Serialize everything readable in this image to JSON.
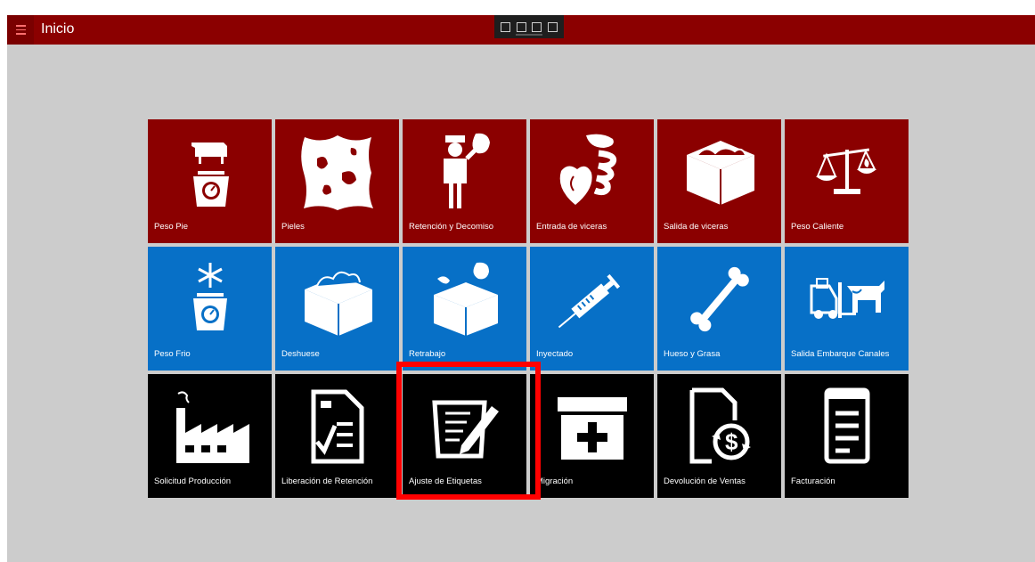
{
  "window": {
    "title": "Inicio"
  },
  "colors": {
    "titlebar": "#8b0000",
    "tile_red": "#8b0000",
    "tile_blue": "#0770c7",
    "tile_black": "#000000",
    "highlight": "#ff0000"
  },
  "debug_toolbar": {
    "icons": [
      "select-element-icon",
      "pointer-icon",
      "layout-icon",
      "track-focus-icon"
    ]
  },
  "tiles": [
    {
      "label": "Peso Pie",
      "icon": "cow-scale-icon",
      "color": "red"
    },
    {
      "label": "Pieles",
      "icon": "hide-icon",
      "color": "red"
    },
    {
      "label": "Retención y Decomiso",
      "icon": "inspector-icon",
      "color": "red"
    },
    {
      "label": "Entrada de viceras",
      "icon": "organs-icon",
      "color": "red"
    },
    {
      "label": "Salida de viceras",
      "icon": "meat-box-icon",
      "color": "red"
    },
    {
      "label": "Peso Caliente",
      "icon": "balance-flame-icon",
      "color": "red"
    },
    {
      "label": "Peso Frio",
      "icon": "cold-scale-icon",
      "color": "blue"
    },
    {
      "label": "Deshuese",
      "icon": "meat-box-icon",
      "color": "blue"
    },
    {
      "label": "Retrabajo",
      "icon": "meat-box-rework-icon",
      "color": "blue"
    },
    {
      "label": "Inyectado",
      "icon": "syringe-icon",
      "color": "blue"
    },
    {
      "label": "Hueso y Grasa",
      "icon": "bone-icon",
      "color": "blue"
    },
    {
      "label": "Salida Embarque Canales",
      "icon": "forklift-cow-icon",
      "color": "blue"
    },
    {
      "label": "Solicitud Producción",
      "icon": "factory-icon",
      "color": "black"
    },
    {
      "label": "Liberación de Retención",
      "icon": "checklist-document-icon",
      "color": "black"
    },
    {
      "label": "Ajuste de Etiquetas",
      "icon": "edit-document-icon",
      "color": "black"
    },
    {
      "label": "Migración",
      "icon": "add-box-icon",
      "color": "black"
    },
    {
      "label": "Devolución de Ventas",
      "icon": "money-return-icon",
      "color": "black"
    },
    {
      "label": "Facturación",
      "icon": "invoice-icon",
      "color": "black"
    }
  ]
}
